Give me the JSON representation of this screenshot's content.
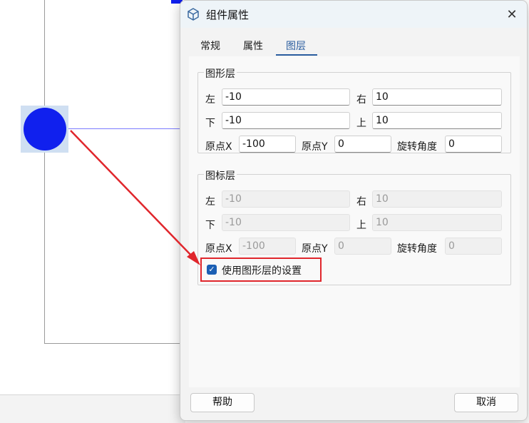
{
  "dialog": {
    "title": "组件属性",
    "close_label": "✕"
  },
  "tabs": [
    {
      "label": "常规"
    },
    {
      "label": "属性"
    },
    {
      "label": "图层"
    }
  ],
  "graphic_layer": {
    "label": "图形层",
    "left_label": "左",
    "left_value": "-10",
    "right_label": "右",
    "right_value": "10",
    "bottom_label": "下",
    "bottom_value": "-10",
    "top_label": "上",
    "top_value": "10",
    "origin_x_label": "原点X",
    "origin_x_value": "-100",
    "origin_y_label": "原点Y",
    "origin_y_value": "0",
    "rotation_label": "旋转角度",
    "rotation_value": "0"
  },
  "icon_layer": {
    "label": "图标层",
    "left_label": "左",
    "left_value": "-10",
    "right_label": "右",
    "right_value": "10",
    "bottom_label": "下",
    "bottom_value": "-10",
    "top_label": "上",
    "top_value": "10",
    "origin_x_label": "原点X",
    "origin_x_value": "-100",
    "origin_y_label": "原点Y",
    "origin_y_value": "0",
    "rotation_label": "旋转角度",
    "rotation_value": "0"
  },
  "use_graphic_settings": {
    "label": "使用图形层的设置",
    "checked": true
  },
  "buttons": {
    "help": "帮助",
    "cancel": "取消"
  },
  "colors": {
    "accent": "#2a5d9f",
    "node": "#1020ee",
    "highlight": "#e0262c"
  }
}
